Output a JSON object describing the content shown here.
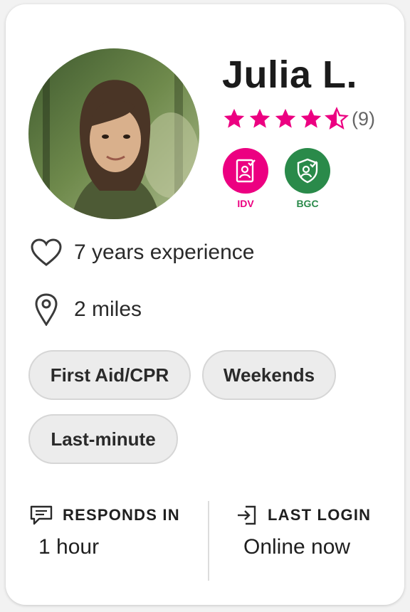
{
  "profile": {
    "name": "Julia L.",
    "rating": 4.5,
    "review_count": "(9)"
  },
  "badges": [
    {
      "label": "IDV",
      "icon": "id-document-icon",
      "color": "#ec0081"
    },
    {
      "label": "BGC",
      "icon": "shield-person-icon",
      "color": "#2a8a4a"
    }
  ],
  "info": {
    "experience": "7 years experience",
    "distance": "2 miles"
  },
  "tags": [
    "First Aid/CPR",
    "Weekends",
    "Last-minute"
  ],
  "stats": {
    "responds_label": "RESPONDS IN",
    "responds_value": "1 hour",
    "login_label": "LAST LOGIN",
    "login_value": "Online now"
  },
  "colors": {
    "accent": "#ec0081",
    "verified": "#2a8a4a",
    "tag_bg": "#ececec"
  }
}
